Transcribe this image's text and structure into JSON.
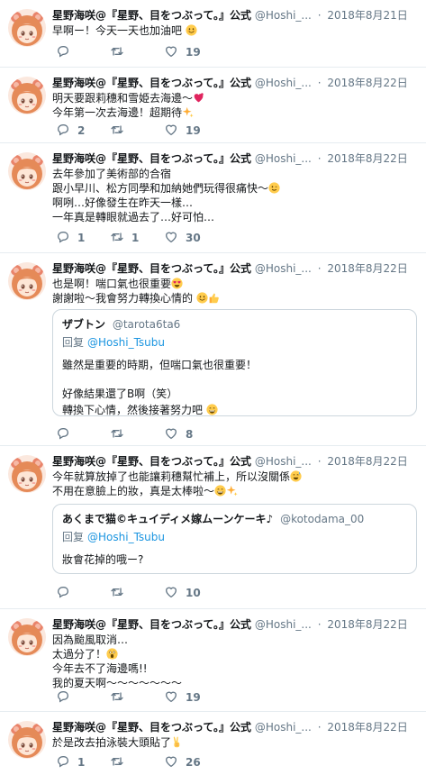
{
  "colors": {
    "name": "#14171a",
    "muted": "#657786",
    "link": "#1b95e0",
    "divider": "#e6ecf0",
    "heart_emoji": "#e0245e",
    "emoji_yellow": "#ffcc4d"
  },
  "tweets": [
    {
      "name": "星野海咲@『星野、目をつぶって。』公式",
      "handle": "@Hoshi_...",
      "dot": "·",
      "date": "2018年8月21日",
      "lines": [
        "早啊ー！今天一天也加油吧"
      ],
      "reply_count": "",
      "retweet_count": "",
      "like_count": "19"
    },
    {
      "name": "星野海咲@『星野、目をつぶって。』公式",
      "handle": "@Hoshi_...",
      "dot": "·",
      "date": "2018年8月22日",
      "lines": [
        "明天要跟莉穗和雪姫去海邊～",
        "今年第一次去海邊！超期待"
      ],
      "reply_count": "2",
      "retweet_count": "",
      "like_count": "19"
    },
    {
      "name": "星野海咲@『星野、目をつぶって。』公式",
      "handle": "@Hoshi_...",
      "dot": "·",
      "date": "2018年8月22日",
      "lines": [
        "去年參加了美術部的合宿",
        "跟小早川、松方同學和加納她們玩得很痛快～",
        "啊咧…好像發生在昨天一樣…",
        "一年真是轉眼就過去了…好可怕…"
      ],
      "reply_count": "1",
      "retweet_count": "1",
      "like_count": "30"
    },
    {
      "name": "星野海咲@『星野、目をつぶって。』公式",
      "handle": "@Hoshi_...",
      "dot": "·",
      "date": "2018年8月22日",
      "lines": [
        "也是啊！喘口氣也很重要",
        "謝謝啦～我會努力轉換心情的"
      ],
      "quote": {
        "name": "ザブトン",
        "handle": "@tarota6ta6",
        "reply_prefix": "回复",
        "reply_to": "@Hoshi_Tsubu",
        "lines": [
          "雖然是重要的時期，但喘口氣也很重要！",
          "",
          "好像結果還了B啊（笑）",
          "轉換下心情，然後接著努力吧"
        ]
      },
      "reply_count": "",
      "retweet_count": "",
      "like_count": "8"
    },
    {
      "name": "星野海咲@『星野、目をつぶって。』公式",
      "handle": "@Hoshi_...",
      "dot": "·",
      "date": "2018年8月22日",
      "lines": [
        "今年就算放掉了也能讓莉穗幫忙補上，所以沒關係",
        "不用在意臉上的妝，真是太棒啦～"
      ],
      "quote": {
        "name": "あくまで猫©キュイディメ嫁ムーンケーキ♪",
        "handle": "@kotodama_00",
        "reply_prefix": "回复",
        "reply_to": "@Hoshi_Tsubu",
        "lines": [
          "妝會花掉的哦ー?"
        ]
      },
      "reply_count": "",
      "retweet_count": "",
      "like_count": "10"
    },
    {
      "name": "星野海咲@『星野、目をつぶって。』公式",
      "handle": "@Hoshi_...",
      "dot": "·",
      "date": "2018年8月22日",
      "lines": [
        "因為颱風取消…",
        "太過分了！",
        "今年去不了海邊嗎!!",
        "我的夏天啊～～～～～～～"
      ],
      "reply_count": "",
      "retweet_count": "",
      "like_count": "19"
    },
    {
      "name": "星野海咲@『星野、目をつぶって。』公式",
      "handle": "@Hoshi_...",
      "dot": "·",
      "date": "2018年8月22日",
      "lines": [
        "於是改去拍泳裝大頭貼了"
      ],
      "reply_count": "1",
      "retweet_count": "",
      "like_count": "26"
    }
  ]
}
